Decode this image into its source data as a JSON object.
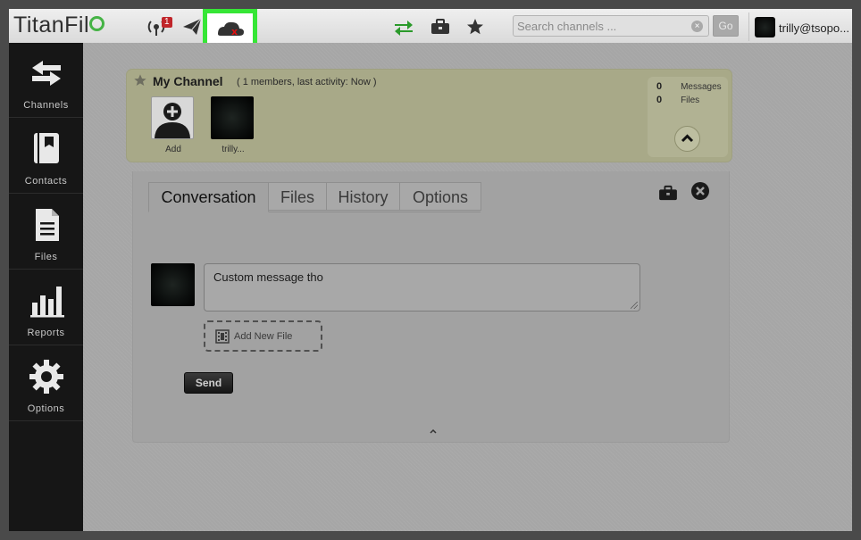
{
  "app": {
    "logo_text": "TitanFil"
  },
  "toolbar": {
    "notification_count": "1",
    "search_placeholder": "Search channels ...",
    "search_clear": "×",
    "go_label": "Go",
    "user_name": "trilly@tsopo..."
  },
  "sidebar": {
    "items": [
      {
        "label": "Channels",
        "icon": "swap-arrows-icon"
      },
      {
        "label": "Contacts",
        "icon": "address-book-icon"
      },
      {
        "label": "Files",
        "icon": "file-icon"
      },
      {
        "label": "Reports",
        "icon": "bar-chart-icon"
      },
      {
        "label": "Options",
        "icon": "gear-icon"
      }
    ]
  },
  "channel": {
    "title": "My Channel",
    "meta": "( 1 members, last activity: Now )",
    "members": [
      {
        "name": "Add",
        "icon": "add-member-icon"
      },
      {
        "name": "trilly..."
      }
    ],
    "stats": {
      "messages_count": "0",
      "messages_label": "Messages",
      "files_count": "0",
      "files_label": "Files"
    }
  },
  "tabs": [
    {
      "label": "Conversation",
      "active": true
    },
    {
      "label": "Files"
    },
    {
      "label": "History"
    },
    {
      "label": "Options"
    }
  ],
  "composer": {
    "message": "Custom message tho",
    "add_file_label": "Add New File",
    "send_label": "Send"
  },
  "colors": {
    "highlight": "#36e636",
    "accent_green": "#45b345",
    "badge_red": "#c0252a",
    "sidebar_bg": "#161616"
  }
}
